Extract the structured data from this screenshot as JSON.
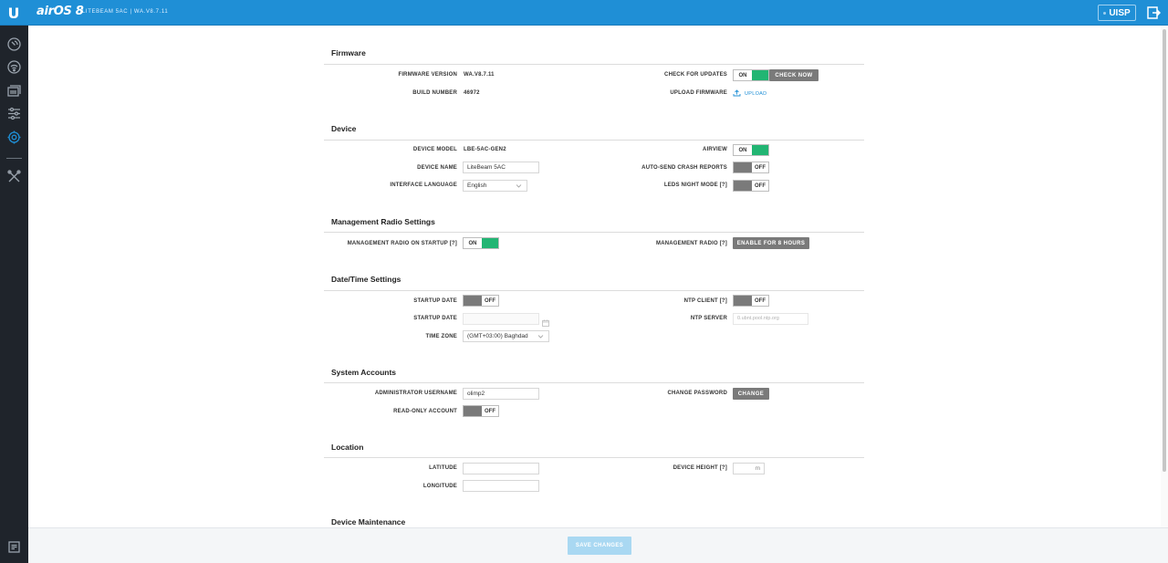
{
  "header": {
    "logo": "U",
    "brand": "airOS 8",
    "device_info": "LITEBEAM 5AC | WA.V8.7.11",
    "uisp": "UISP"
  },
  "firmware": {
    "title": "Firmware",
    "version_label": "FIRMWARE VERSION",
    "version_value": "WA.V8.7.11",
    "build_label": "BUILD NUMBER",
    "build_value": "46972",
    "check_label": "CHECK FOR UPDATES",
    "check_toggle": "ON",
    "check_now": "CHECK NOW",
    "upload_label": "UPLOAD FIRMWARE",
    "upload_link": "UPLOAD"
  },
  "device": {
    "title": "Device",
    "model_label": "DEVICE MODEL",
    "model_value": "LBE-5AC-GEN2",
    "name_label": "DEVICE NAME",
    "name_value": "LiteBeam 5AC",
    "lang_label": "INTERFACE LANGUAGE",
    "lang_value": "English",
    "airview_label": "AIRVIEW",
    "airview_toggle": "ON",
    "crash_label": "AUTO-SEND CRASH REPORTS",
    "crash_toggle": "OFF",
    "leds_label": "LEDS NIGHT MODE [?]",
    "leds_toggle": "OFF"
  },
  "mgmt_radio": {
    "title": "Management Radio Settings",
    "startup_label": "MANAGEMENT RADIO ON STARTUP [?]",
    "startup_toggle": "ON",
    "radio_label": "MANAGEMENT RADIO [?]",
    "radio_button": "ENABLE FOR 8 HOURS"
  },
  "datetime": {
    "title": "Date/Time Settings",
    "startup_date_label": "STARTUP DATE",
    "startup_date_toggle": "OFF",
    "startup_date2_label": "STARTUP DATE",
    "timezone_label": "TIME ZONE",
    "timezone_value": "(GMT+03:00) Baghdad",
    "ntp_client_label": "NTP CLIENT [?]",
    "ntp_client_toggle": "OFF",
    "ntp_server_label": "NTP SERVER",
    "ntp_server_placeholder": "0.ubnt.pool.ntp.org"
  },
  "accounts": {
    "title": "System Accounts",
    "admin_label": "ADMINISTRATOR USERNAME",
    "admin_value": "olimp2",
    "readonly_label": "READ-ONLY ACCOUNT",
    "readonly_toggle": "OFF",
    "change_pw_label": "CHANGE PASSWORD",
    "change_button": "CHANGE"
  },
  "location": {
    "title": "Location",
    "lat_label": "LATITUDE",
    "lon_label": "LONGITUDE",
    "height_label": "DEVICE HEIGHT [?]",
    "height_unit": "m"
  },
  "maintenance": {
    "title": "Device Maintenance"
  },
  "footer": {
    "save": "SAVE CHANGES"
  }
}
